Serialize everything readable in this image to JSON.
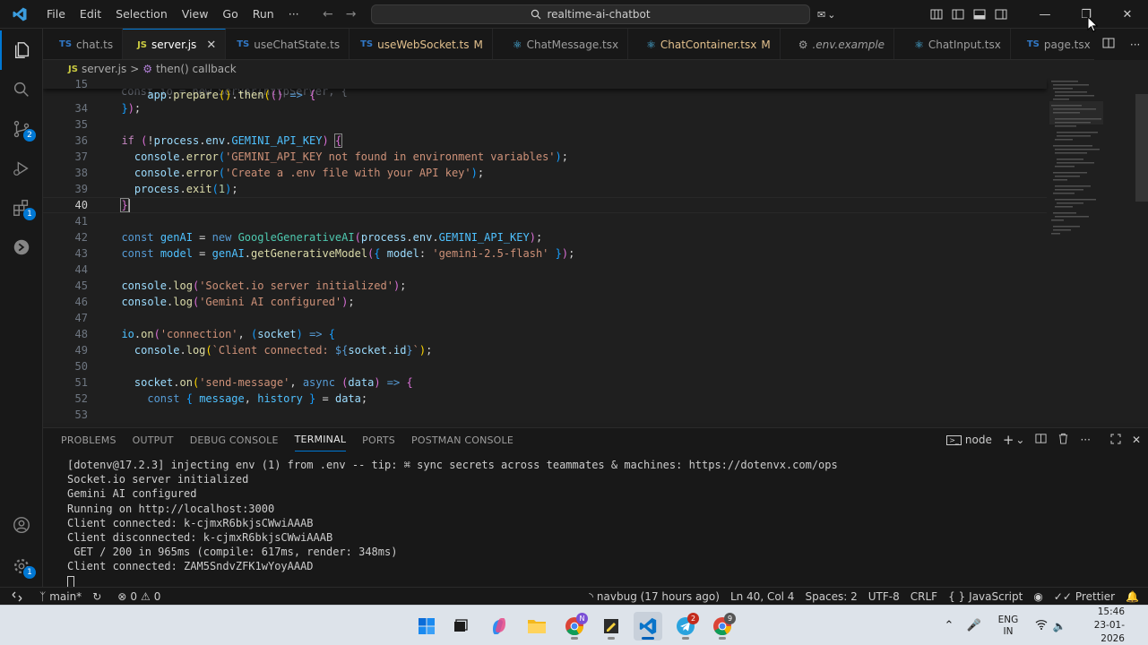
{
  "window": {
    "search_text": "realtime-ai-chatbot"
  },
  "menu": [
    "File",
    "Edit",
    "Selection",
    "View",
    "Go",
    "Run",
    "···"
  ],
  "activity_badges": {
    "source_control": "2",
    "extensions": "1",
    "settings": "1"
  },
  "tabs": [
    {
      "label": "chat.ts",
      "icon": "TS",
      "active": false,
      "modified": ""
    },
    {
      "label": "server.js",
      "icon": "JS",
      "active": true,
      "modified": ""
    },
    {
      "label": "useChatState.ts",
      "icon": "TS",
      "active": false,
      "modified": ""
    },
    {
      "label": "useWebSocket.ts",
      "icon": "TS",
      "active": false,
      "modified": "M"
    },
    {
      "label": "ChatMessage.tsx",
      "icon": "react",
      "active": false,
      "modified": ""
    },
    {
      "label": "ChatContainer.tsx",
      "icon": "react",
      "active": false,
      "modified": "M"
    },
    {
      "label": ".env.example",
      "icon": "gear",
      "active": false,
      "modified": ""
    },
    {
      "label": "ChatInput.tsx",
      "icon": "react",
      "active": false,
      "modified": ""
    },
    {
      "label": "page.tsx",
      "icon": "TS",
      "active": false,
      "modified": ""
    }
  ],
  "breadcrumb": {
    "file": "server.js",
    "separator": ">",
    "symbol": "then() callback"
  },
  "editor": {
    "sticky": {
      "num": "15",
      "text": "app.prepare().then(() => {"
    },
    "sticky_overlap": "const io = new Server(httpServer, {",
    "lines": [
      {
        "num": "34",
        "text": "  });"
      },
      {
        "num": "35",
        "text": ""
      },
      {
        "num": "36",
        "text": "  if (!process.env.GEMINI_API_KEY) {"
      },
      {
        "num": "37",
        "text": "    console.error('GEMINI_API_KEY not found in environment variables');"
      },
      {
        "num": "38",
        "text": "    console.error('Create a .env file with your API key');"
      },
      {
        "num": "39",
        "text": "    process.exit(1);"
      },
      {
        "num": "40",
        "text": "  }"
      },
      {
        "num": "41",
        "text": ""
      },
      {
        "num": "42",
        "text": "  const genAI = new GoogleGenerativeAI(process.env.GEMINI_API_KEY);"
      },
      {
        "num": "43",
        "text": "  const model = genAI.getGenerativeModel({ model: 'gemini-2.5-flash' });"
      },
      {
        "num": "44",
        "text": ""
      },
      {
        "num": "45",
        "text": "  console.log('Socket.io server initialized');"
      },
      {
        "num": "46",
        "text": "  console.log('Gemini AI configured');"
      },
      {
        "num": "47",
        "text": ""
      },
      {
        "num": "48",
        "text": "  io.on('connection', (socket) => {"
      },
      {
        "num": "49",
        "text": "    console.log(`Client connected: ${socket.id}`);"
      },
      {
        "num": "50",
        "text": ""
      },
      {
        "num": "51",
        "text": "    socket.on('send-message', async (data) => {"
      },
      {
        "num": "52",
        "text": "      const { message, history } = data;"
      },
      {
        "num": "53",
        "text": ""
      }
    ]
  },
  "panel": {
    "tabs": [
      "PROBLEMS",
      "OUTPUT",
      "DEBUG CONSOLE",
      "TERMINAL",
      "PORTS",
      "POSTMAN CONSOLE"
    ],
    "active_tab": "TERMINAL",
    "terminal_name": "node",
    "terminal_lines": [
      "[dotenv@17.2.3] injecting env (1) from .env -- tip: ⌘ sync secrets across teammates & machines: https://dotenvx.com/ops",
      "Socket.io server initialized",
      "Gemini AI configured",
      "Running on http://localhost:3000",
      "Client connected: k-cjmxR6bkjsCWwiAAAB",
      "Client disconnected: k-cjmxR6bkjsCWwiAAAB",
      " GET / 200 in 965ms (compile: 617ms, render: 348ms)",
      "Client connected: ZAM5SndvZFK1wYoyAAAD"
    ]
  },
  "statusbar": {
    "branch": "main*",
    "errors": "0",
    "warnings": "0",
    "blame": "navbug (17 hours ago)",
    "position": "Ln 40, Col 4",
    "spaces": "Spaces: 2",
    "encoding": "UTF-8",
    "eol": "CRLF",
    "language": "JavaScript",
    "formatter": "Prettier"
  },
  "taskbar": {
    "badges": {
      "chrome": "N",
      "telegram": "2",
      "chrome2": "9"
    },
    "lang": "ENG",
    "region": "IN",
    "time": "15:46",
    "date": "23-01-2026"
  },
  "colors": {
    "accent": "#0078d4",
    "editor_bg": "#1f1f1f",
    "chrome_bg": "#181818"
  }
}
